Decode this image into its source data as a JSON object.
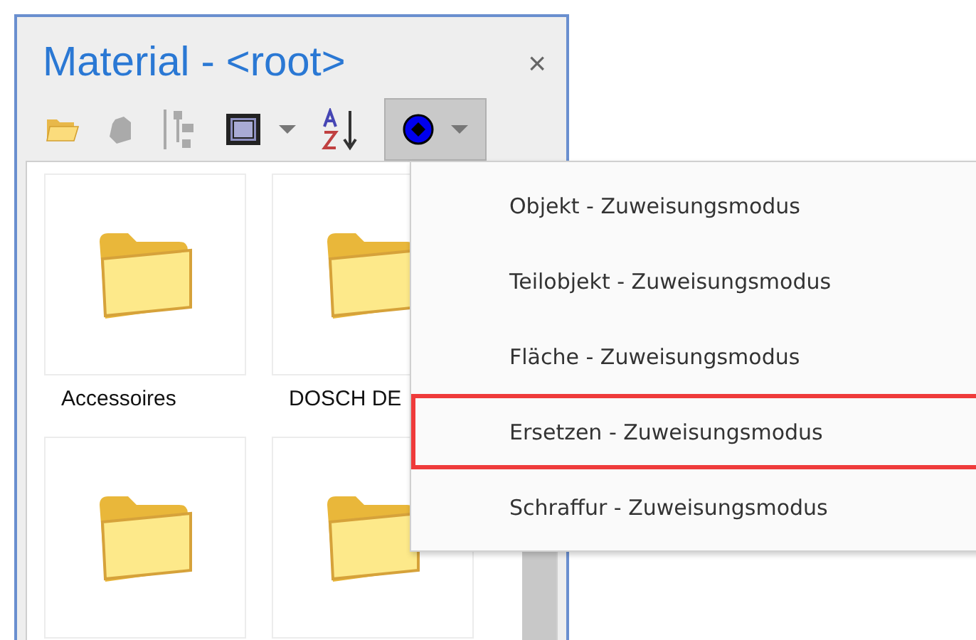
{
  "panel": {
    "title": "Material - <root>",
    "close": "×"
  },
  "toolbar": [
    {
      "kind": "folder",
      "disabled": false,
      "dropdown": false,
      "selected": false
    },
    {
      "kind": "shape",
      "disabled": true,
      "dropdown": false,
      "selected": false
    },
    {
      "kind": "tree",
      "disabled": true,
      "dropdown": false,
      "selected": false
    },
    {
      "kind": "frame",
      "disabled": false,
      "dropdown": true,
      "selected": false
    },
    {
      "kind": "sort",
      "disabled": false,
      "dropdown": false,
      "selected": false
    },
    {
      "kind": "mode",
      "disabled": false,
      "dropdown": true,
      "selected": true
    }
  ],
  "tiles": [
    {
      "kind": "folder",
      "label": "Accessoires"
    },
    {
      "kind": "folder",
      "label": "DOSCH DE"
    },
    {
      "kind": "folder"
    },
    {
      "kind": "folder"
    }
  ],
  "menu": [
    {
      "label": "Objekt - Zuweisungsmodus",
      "selected": false
    },
    {
      "label": "Teilobjekt - Zuweisungsmodus",
      "selected": false
    },
    {
      "label": "Fläche - Zuweisungsmodus",
      "selected": false
    },
    {
      "label": "Ersetzen - Zuweisungsmodus",
      "selected": true
    },
    {
      "label": "Schraffur - Zuweisungsmodus",
      "selected": false
    }
  ]
}
